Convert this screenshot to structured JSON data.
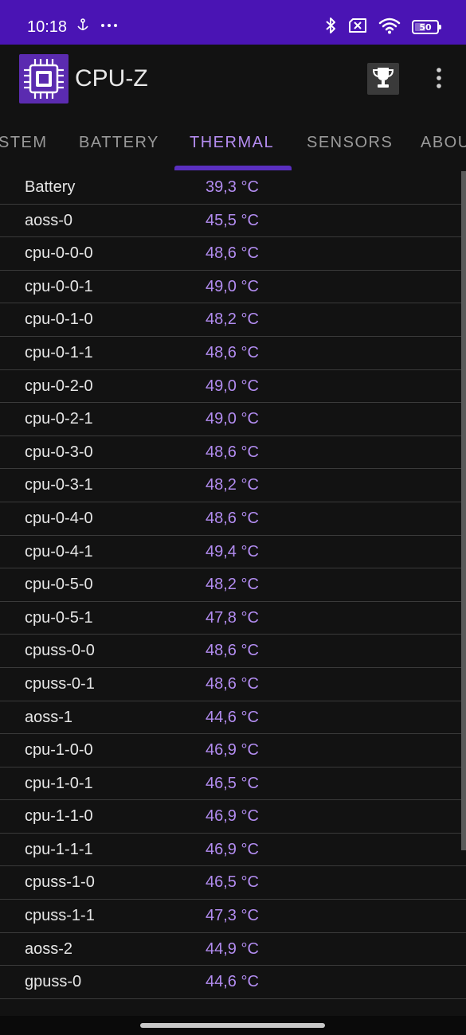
{
  "status_bar": {
    "time": "10:18",
    "battery_level": "50",
    "battery_fraction": 0.5,
    "icons": [
      "anchor-icon",
      "more-dots-icon",
      "bluetooth-icon",
      "no-sim-icon",
      "wifi-icon",
      "battery-icon"
    ]
  },
  "app": {
    "title": "CPU-Z",
    "accent_color": "#4a14b4",
    "value_color": "#b28cf0"
  },
  "tabs": [
    {
      "label": "STEM",
      "active": false
    },
    {
      "label": "BATTERY",
      "active": false
    },
    {
      "label": "THERMAL",
      "active": true
    },
    {
      "label": "SENSORS",
      "active": false
    },
    {
      "label": "ABOU",
      "active": false
    }
  ],
  "thermal": [
    {
      "name": "Battery",
      "temp": "39,3 °C"
    },
    {
      "name": "aoss-0",
      "temp": "45,5 °C"
    },
    {
      "name": "cpu-0-0-0",
      "temp": "48,6 °C"
    },
    {
      "name": "cpu-0-0-1",
      "temp": "49,0 °C"
    },
    {
      "name": "cpu-0-1-0",
      "temp": "48,2 °C"
    },
    {
      "name": "cpu-0-1-1",
      "temp": "48,6 °C"
    },
    {
      "name": "cpu-0-2-0",
      "temp": "49,0 °C"
    },
    {
      "name": "cpu-0-2-1",
      "temp": "49,0 °C"
    },
    {
      "name": "cpu-0-3-0",
      "temp": "48,6 °C"
    },
    {
      "name": "cpu-0-3-1",
      "temp": "48,2 °C"
    },
    {
      "name": "cpu-0-4-0",
      "temp": "48,6 °C"
    },
    {
      "name": "cpu-0-4-1",
      "temp": "49,4 °C"
    },
    {
      "name": "cpu-0-5-0",
      "temp": "48,2 °C"
    },
    {
      "name": "cpu-0-5-1",
      "temp": "47,8 °C"
    },
    {
      "name": "cpuss-0-0",
      "temp": "48,6 °C"
    },
    {
      "name": "cpuss-0-1",
      "temp": "48,6 °C"
    },
    {
      "name": "aoss-1",
      "temp": "44,6 °C"
    },
    {
      "name": "cpu-1-0-0",
      "temp": "46,9 °C"
    },
    {
      "name": "cpu-1-0-1",
      "temp": "46,5 °C"
    },
    {
      "name": "cpu-1-1-0",
      "temp": "46,9 °C"
    },
    {
      "name": "cpu-1-1-1",
      "temp": "46,9 °C"
    },
    {
      "name": "cpuss-1-0",
      "temp": "46,5 °C"
    },
    {
      "name": "cpuss-1-1",
      "temp": "47,3 °C"
    },
    {
      "name": "aoss-2",
      "temp": "44,9 °C"
    },
    {
      "name": "gpuss-0",
      "temp": "44,6 °C"
    }
  ]
}
